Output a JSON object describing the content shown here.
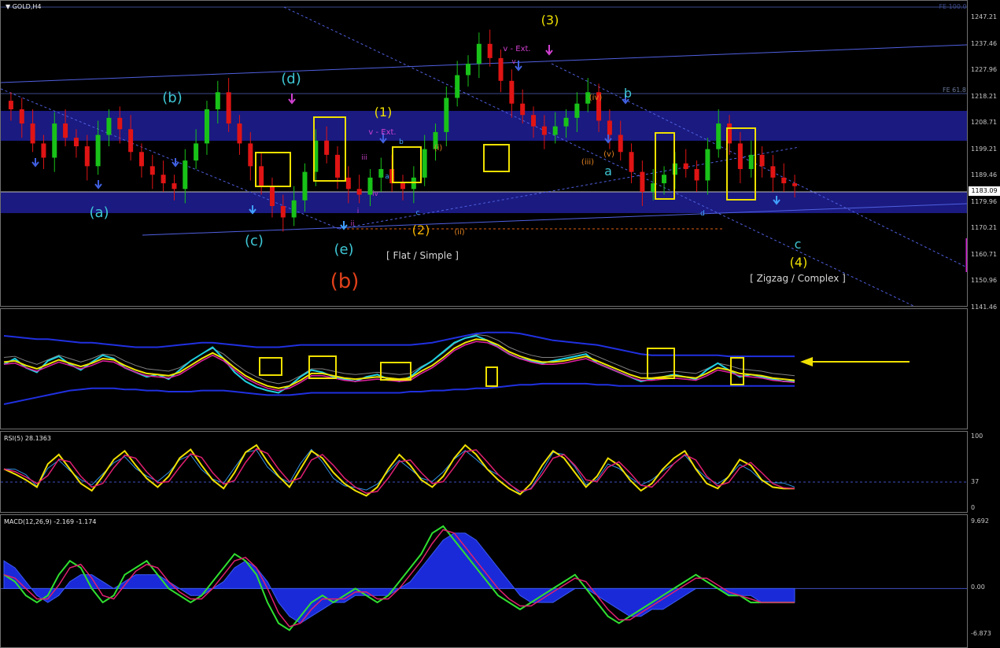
{
  "window": {
    "title": "GOLD,H4",
    "menu_icon": "triangle-down-icon"
  },
  "main": {
    "fe_labels": [
      "FE 100.0",
      "FE 61.8"
    ],
    "price_ticks": [
      "1247.21",
      "1237.46",
      "1227.96",
      "1218.21",
      "1208.71",
      "1199.21",
      "1189.46",
      "1179.96",
      "1170.21",
      "1160.71",
      "1150.96",
      "1141.46"
    ],
    "current_price": "1183.09",
    "wave_labels": [
      {
        "t": "(a)",
        "c": "#3ec6d4"
      },
      {
        "t": "(b)",
        "c": "#3ec6d4"
      },
      {
        "t": "(c)",
        "c": "#3ec6d4"
      },
      {
        "t": "(d)",
        "c": "#3ec6d4"
      },
      {
        "t": "(e)",
        "c": "#3ec6d4"
      },
      {
        "t": "(b)",
        "c": "#e0401a"
      },
      {
        "t": "(1)",
        "c": "#f0e000"
      },
      {
        "t": "(2)",
        "c": "#f0b000"
      },
      {
        "t": "(3)",
        "c": "#f0e000"
      },
      {
        "t": "(4)",
        "c": "#f0e000"
      },
      {
        "t": "a",
        "c": "#3ec6d4"
      },
      {
        "t": "b",
        "c": "#3ec6d4"
      },
      {
        "t": "c",
        "c": "#3ec6d4"
      },
      {
        "t": "v - Ext.",
        "c": "#d040d0"
      },
      {
        "t": "v - Ext.",
        "c": "#d040d0"
      },
      {
        "t": "(i)",
        "c": "#e08020"
      },
      {
        "t": "(ii)",
        "c": "#e08020"
      },
      {
        "t": "(iii)",
        "c": "#e08020"
      },
      {
        "t": "(iv)",
        "c": "#e08020"
      },
      {
        "t": "(v)",
        "c": "#e08020"
      },
      {
        "t": "i",
        "c": "#c040c0"
      },
      {
        "t": "ii",
        "c": "#c040c0"
      },
      {
        "t": "iii",
        "c": "#c040c0"
      },
      {
        "t": "iv",
        "c": "#c040c0"
      },
      {
        "t": "v",
        "c": "#c040c0"
      },
      {
        "t": "a",
        "c": "#40a0ff"
      },
      {
        "t": "b",
        "c": "#40a0ff"
      },
      {
        "t": "c",
        "c": "#40a0ff"
      },
      {
        "t": "d",
        "c": "#40a0ff"
      }
    ],
    "notes": [
      "[ Flat / Simple ]",
      "[ Zigzag / Complex ]"
    ]
  },
  "indicators": {
    "rsi": {
      "label": "RSI(5) 28.1363",
      "ticks": [
        "100",
        "37",
        "0"
      ]
    },
    "macd": {
      "label": "MACD(12,26,9) -2.169 -1.174",
      "ticks": [
        "9.692",
        "0.00",
        "-6.873"
      ]
    }
  },
  "chart_data": [
    {
      "type": "candlestick",
      "symbol": "GOLD",
      "timeframe": "H4",
      "ylim": [
        1141.46,
        1252
      ],
      "last_close": 1183.09,
      "key_points": [
        {
          "wave": "(a)",
          "y": 1181
        },
        {
          "wave": "(b)",
          "y": 1212
        },
        {
          "wave": "(c)",
          "y": 1176
        },
        {
          "wave": "(d)",
          "y": 1216
        },
        {
          "wave": "(e)",
          "y": 1172
        },
        {
          "wave": "(1)",
          "y": 1199
        },
        {
          "wave": "(2)",
          "y": 1180
        },
        {
          "wave": "(3)",
          "y": 1234
        },
        {
          "wave": "(4)",
          "y": 1163
        }
      ],
      "close_path": [
        1210,
        1205,
        1198,
        1193,
        1205,
        1200,
        1197,
        1190,
        1201,
        1207,
        1203,
        1195,
        1190,
        1187,
        1184,
        1182,
        1192,
        1198,
        1210,
        1216,
        1205,
        1198,
        1190,
        1183,
        1176,
        1172,
        1178,
        1188,
        1199,
        1194,
        1186,
        1182,
        1180,
        1186,
        1189,
        1184,
        1182,
        1186,
        1196,
        1202,
        1214,
        1222,
        1226,
        1233,
        1228,
        1220,
        1212,
        1208,
        1204,
        1201,
        1204,
        1207,
        1212,
        1216,
        1206,
        1201,
        1195,
        1188,
        1181,
        1184,
        1187,
        1191,
        1189,
        1185,
        1196,
        1205,
        1198,
        1189,
        1194,
        1190,
        1186,
        1184,
        1183
      ]
    },
    {
      "type": "line",
      "name": "oscillator overlay",
      "ylim": [
        0,
        100
      ],
      "x_count": 73,
      "series": [
        {
          "values": [
            55,
            60,
            52,
            48,
            58,
            62,
            55,
            50,
            57,
            63,
            60,
            52,
            48,
            44,
            46,
            42,
            50,
            58,
            64,
            70,
            60,
            48,
            40,
            35,
            32,
            30,
            36,
            44,
            50,
            48,
            44,
            42,
            40,
            44,
            46,
            42,
            40,
            44,
            52,
            58,
            66,
            74,
            78,
            80,
            76,
            70,
            64,
            60,
            58,
            56,
            58,
            60,
            62,
            64,
            56,
            52,
            48,
            44,
            40,
            42,
            44,
            46,
            44,
            42,
            50,
            56,
            50,
            44,
            46,
            44,
            42,
            40,
            40
          ]
        },
        {
          "values": [
            57,
            58,
            54,
            51,
            55,
            59,
            56,
            53,
            56,
            60,
            59,
            54,
            50,
            47,
            46,
            45,
            48,
            54,
            60,
            65,
            60,
            52,
            45,
            40,
            36,
            34,
            36,
            41,
            47,
            47,
            45,
            43,
            42,
            43,
            44,
            43,
            42,
            43,
            49,
            54,
            61,
            69,
            74,
            77,
            76,
            72,
            66,
            62,
            59,
            57,
            57,
            58,
            60,
            62,
            58,
            54,
            50,
            46,
            43,
            43,
            44,
            45,
            44,
            43,
            47,
            52,
            50,
            47,
            46,
            45,
            43,
            42,
            41
          ]
        }
      ],
      "band_upper": [
        80,
        79,
        78,
        77,
        77,
        76,
        75,
        74,
        74,
        73,
        72,
        71,
        70,
        70,
        70,
        71,
        72,
        73,
        74,
        74,
        73,
        72,
        71,
        70,
        70,
        70,
        71,
        72,
        72,
        72,
        72,
        72,
        72,
        72,
        72,
        72,
        72,
        72,
        73,
        74,
        76,
        78,
        80,
        82,
        83,
        83,
        83,
        82,
        80,
        78,
        76,
        75,
        74,
        73,
        72,
        70,
        68,
        66,
        64,
        63,
        63,
        63,
        63,
        63,
        63,
        63,
        62,
        62,
        62,
        62,
        62,
        62,
        62
      ],
      "band_lower": [
        20,
        22,
        24,
        26,
        28,
        30,
        32,
        33,
        34,
        34,
        34,
        33,
        33,
        32,
        32,
        31,
        31,
        31,
        32,
        32,
        32,
        31,
        30,
        29,
        28,
        28,
        28,
        29,
        30,
        30,
        30,
        30,
        30,
        30,
        30,
        30,
        30,
        31,
        31,
        32,
        32,
        33,
        33,
        34,
        34,
        35,
        36,
        37,
        37,
        38,
        38,
        38,
        38,
        38,
        37,
        37,
        36,
        36,
        36,
        36,
        36,
        36,
        36,
        36,
        36,
        36,
        36,
        36,
        36,
        36,
        36,
        36,
        36
      ]
    },
    {
      "type": "line",
      "name": "RSI(5)",
      "ylim": [
        0,
        100
      ],
      "level": 37,
      "last_value": 28.1363,
      "values": [
        55,
        48,
        40,
        30,
        62,
        75,
        55,
        35,
        25,
        45,
        68,
        80,
        60,
        42,
        30,
        45,
        70,
        82,
        60,
        40,
        28,
        50,
        78,
        88,
        65,
        45,
        30,
        55,
        80,
        70,
        50,
        35,
        25,
        18,
        30,
        55,
        75,
        60,
        40,
        30,
        45,
        70,
        88,
        75,
        55,
        40,
        28,
        20,
        35,
        60,
        80,
        70,
        50,
        30,
        45,
        70,
        60,
        40,
        25,
        35,
        55,
        70,
        80,
        55,
        35,
        28,
        45,
        68,
        60,
        40,
        30,
        28,
        28
      ]
    },
    {
      "type": "line",
      "name": "MACD(12,26,9)",
      "ylim": [
        -6.873,
        9.692
      ],
      "macd_value": -2.169,
      "signal_value": -1.174,
      "values": [
        2,
        1,
        -1,
        -2,
        -1,
        2,
        4,
        3,
        0,
        -2,
        -1,
        2,
        3,
        4,
        2,
        0,
        -1,
        -2,
        -1,
        1,
        3,
        5,
        4,
        2,
        -2,
        -5,
        -6,
        -4,
        -2,
        -1,
        -2,
        -1,
        0,
        -1,
        -2,
        -1,
        1,
        3,
        5,
        8,
        9,
        7,
        5,
        3,
        1,
        -1,
        -2,
        -3,
        -2,
        -1,
        0,
        1,
        2,
        0,
        -2,
        -4,
        -5,
        -4,
        -3,
        -2,
        -1,
        0,
        1,
        2,
        1,
        0,
        -1,
        -1,
        -2,
        -2,
        -2,
        -2,
        -2
      ],
      "histogram": [
        4,
        3,
        1,
        -1,
        -2,
        -1,
        1,
        2,
        2,
        1,
        0,
        1,
        2,
        2,
        2,
        1,
        0,
        -1,
        -1,
        0,
        1,
        3,
        4,
        3,
        1,
        -2,
        -4,
        -5,
        -4,
        -3,
        -2,
        -2,
        -1,
        -1,
        -1,
        -1,
        0,
        1,
        3,
        5,
        7,
        8,
        8,
        7,
        5,
        3,
        1,
        -1,
        -2,
        -2,
        -2,
        -1,
        0,
        0,
        -1,
        -2,
        -3,
        -4,
        -4,
        -3,
        -3,
        -2,
        -1,
        0,
        0,
        0,
        -1,
        -1,
        -1,
        -2,
        -2,
        -2,
        -2
      ]
    }
  ],
  "colors": {
    "bull": "#19c219",
    "bear": "#e01414",
    "band": "#1a1a80",
    "highlight": "#f0e000",
    "axis_text": "#c8c8c8"
  }
}
